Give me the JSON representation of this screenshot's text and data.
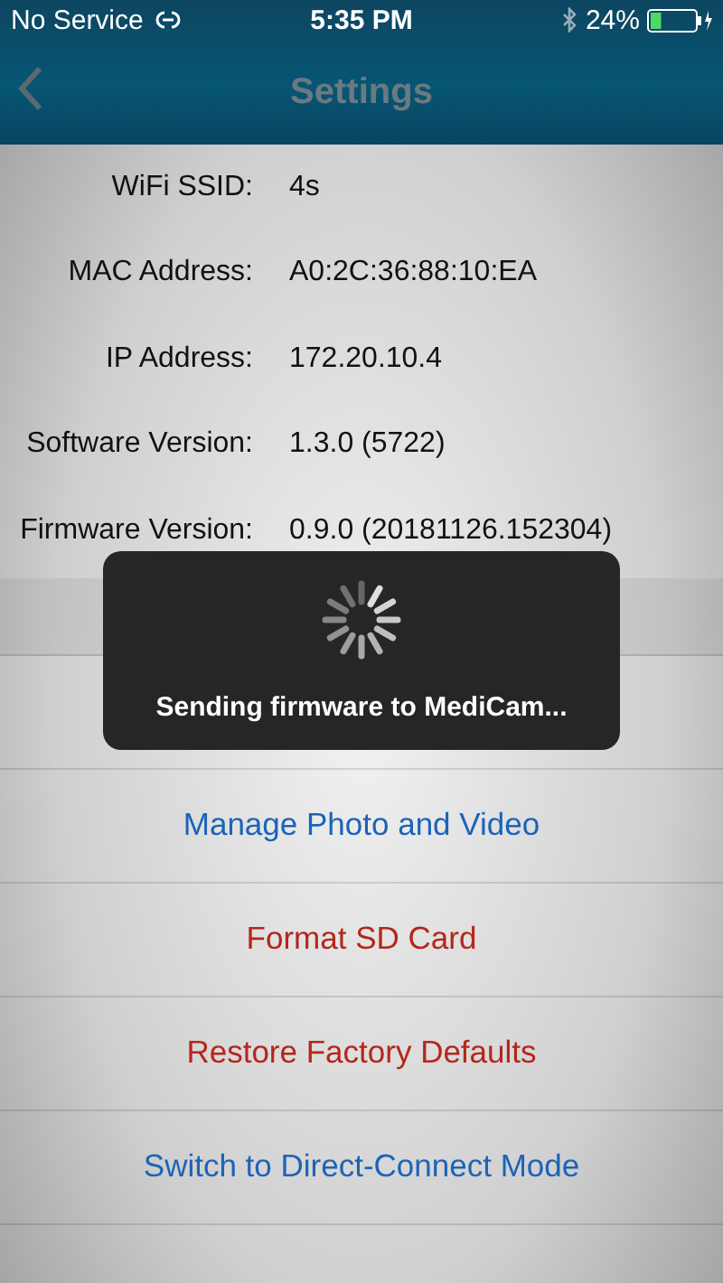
{
  "status_bar": {
    "carrier": "No Service",
    "time": "5:35 PM",
    "battery_text": "24%",
    "battery": {
      "level": 0.24
    }
  },
  "nav": {
    "title": "Settings"
  },
  "info": [
    {
      "label": "WiFi SSID:",
      "value": "4s"
    },
    {
      "label": "MAC Address:",
      "value": "A0:2C:36:88:10:EA"
    },
    {
      "label": "IP Address:",
      "value": "172.20.10.4"
    },
    {
      "label": "Software Version:",
      "value": "1.3.0 (5722)"
    },
    {
      "label": "Firmware Version:",
      "value": "0.9.0 (20181126.152304)"
    }
  ],
  "actions": [
    {
      "label": "Manage Photo and Video",
      "kind": "normal"
    },
    {
      "label": "Format SD Card",
      "kind": "destructive"
    },
    {
      "label": "Restore Factory Defaults",
      "kind": "destructive"
    },
    {
      "label": "Switch to Direct-Connect Mode",
      "kind": "normal"
    }
  ],
  "hud": {
    "message": "Sending firmware to MediCam..."
  }
}
